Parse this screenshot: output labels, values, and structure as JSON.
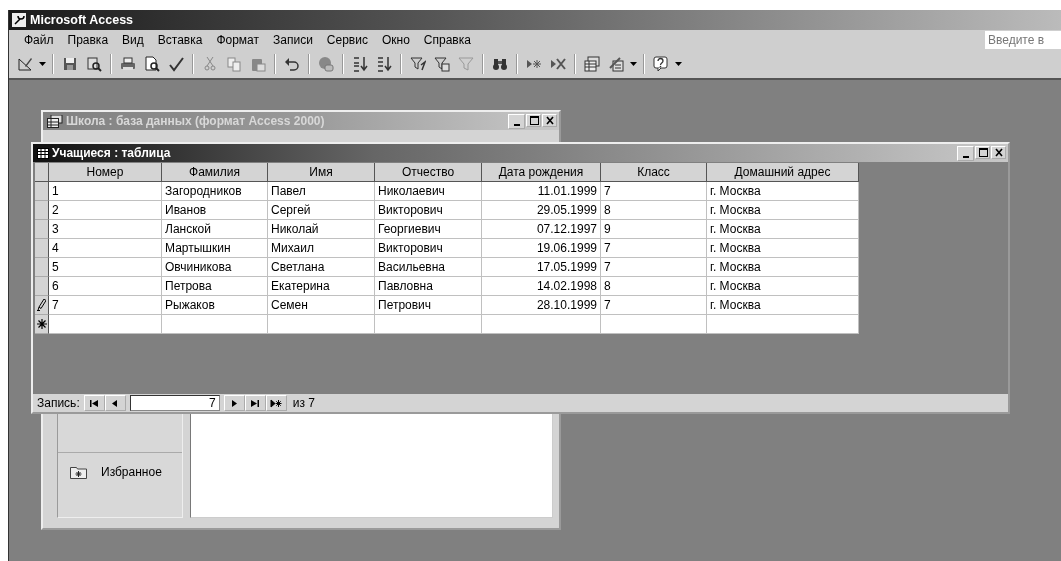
{
  "window": {
    "title": "Microsoft Access"
  },
  "menu": [
    {
      "label": "Файл"
    },
    {
      "label": "Правка"
    },
    {
      "label": "Вид"
    },
    {
      "label": "Вставка"
    },
    {
      "label": "Формат"
    },
    {
      "label": "Записи"
    },
    {
      "label": "Сервис"
    },
    {
      "label": "Окно"
    },
    {
      "label": "Справка"
    }
  ],
  "help_search": {
    "placeholder": "Введите в"
  },
  "database_window": {
    "title": "Школа : база данных (формат Access 2000)",
    "active": false,
    "groups": [
      {
        "label": "Избранное"
      }
    ]
  },
  "table_window": {
    "title": "Учащиеся : таблица",
    "active": true,
    "columns": [
      {
        "label": "Номер",
        "kind": "text"
      },
      {
        "label": "Фамилия",
        "kind": "text"
      },
      {
        "label": "Имя",
        "kind": "text"
      },
      {
        "label": "Отчество",
        "kind": "text"
      },
      {
        "label": "Дата рождения",
        "kind": "date"
      },
      {
        "label": "Класс",
        "kind": "text"
      },
      {
        "label": "Домашний адрес",
        "kind": "text"
      }
    ],
    "rows": [
      {
        "cells": [
          "1",
          "Загородников",
          "Павел",
          "Николаевич",
          "11.01.1999",
          "7",
          "г. Москва"
        ],
        "editing": false
      },
      {
        "cells": [
          "2",
          "Иванов",
          "Сергей",
          "Викторович",
          "29.05.1999",
          "8",
          "г. Москва"
        ],
        "editing": false
      },
      {
        "cells": [
          "3",
          "Ланской",
          "Николай",
          "Георгиевич",
          "07.12.1997",
          "9",
          "г. Москва"
        ],
        "editing": false
      },
      {
        "cells": [
          "4",
          "Мартышкин",
          "Михаил",
          "Викторович",
          "19.06.1999",
          "7",
          "г. Москва"
        ],
        "editing": false
      },
      {
        "cells": [
          "5",
          "Овчиникова",
          "Светлана",
          "Васильевна",
          "17.05.1999",
          "7",
          "г. Москва"
        ],
        "editing": false
      },
      {
        "cells": [
          "6",
          "Петрова",
          "Екатерина",
          "Павловна",
          "14.02.1998",
          "8",
          "г. Москва"
        ],
        "editing": false
      },
      {
        "cells": [
          "7",
          "Рыжаков",
          "Семен",
          "Петрович",
          "28.10.1999",
          "7",
          "г. Москва"
        ],
        "editing": true
      }
    ],
    "new_row": true,
    "navigator": {
      "label": "Запись:",
      "current": "7",
      "total": "из 7"
    }
  }
}
